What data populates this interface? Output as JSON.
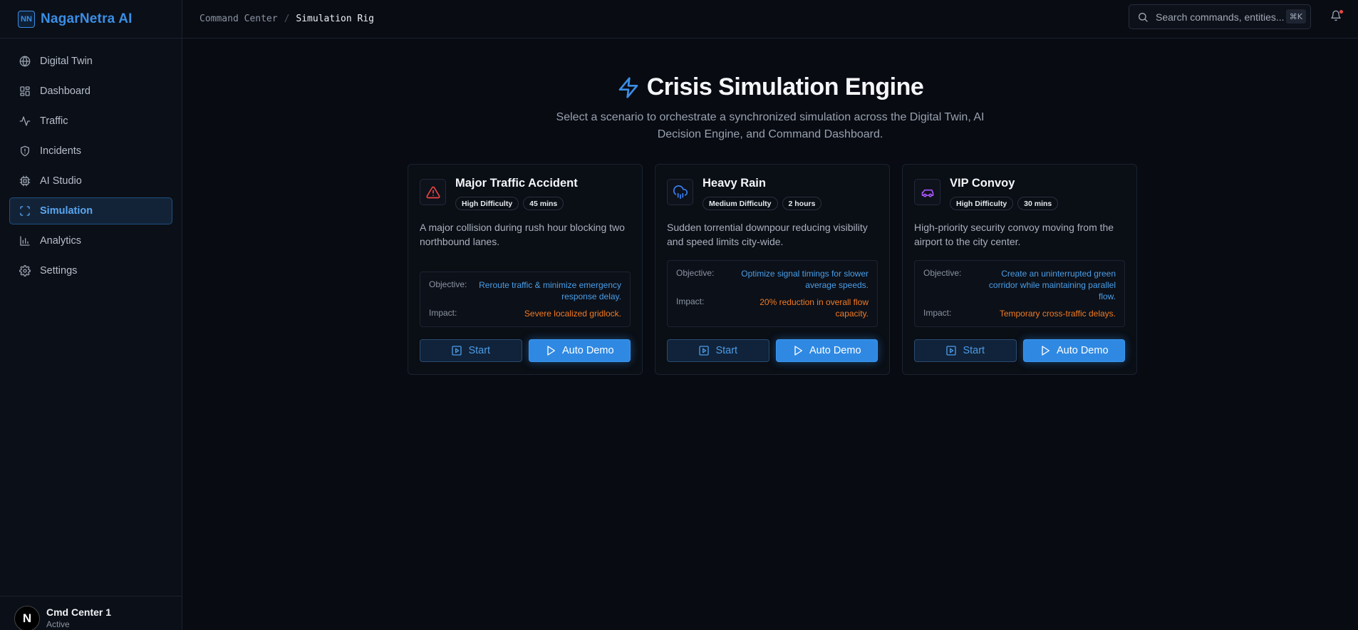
{
  "app": {
    "logo_mark": "NN",
    "name": "NagarNetra AI"
  },
  "sidebar": {
    "items": [
      {
        "label": "Digital Twin",
        "icon": "globe-icon",
        "active": false
      },
      {
        "label": "Dashboard",
        "icon": "grid-icon",
        "active": false
      },
      {
        "label": "Traffic",
        "icon": "activity-icon",
        "active": false
      },
      {
        "label": "Incidents",
        "icon": "shield-icon",
        "active": false
      },
      {
        "label": "AI Studio",
        "icon": "cpu-icon",
        "active": false
      },
      {
        "label": "Simulation",
        "icon": "scan-icon",
        "active": true
      },
      {
        "label": "Analytics",
        "icon": "bar-chart-icon",
        "active": false
      },
      {
        "label": "Settings",
        "icon": "gear-icon",
        "active": false
      }
    ],
    "user": {
      "initial": "N",
      "name": "Cmd Center 1",
      "status": "Active"
    }
  },
  "topbar": {
    "breadcrumb": [
      "Command Center",
      "Simulation Rig"
    ],
    "separator": "/",
    "search_placeholder": "Search commands, entities...",
    "shortcut": "⌘K"
  },
  "hero": {
    "title": "Crisis Simulation Engine",
    "subtitle": "Select a scenario to orchestrate a synchronized simulation across the Digital Twin, AI Decision Engine, and Command Dashboard."
  },
  "labels": {
    "objective": "Objective:",
    "impact": "Impact:",
    "start": "Start",
    "auto_demo": "Auto Demo"
  },
  "scenarios": [
    {
      "title": "Major Traffic Accident",
      "icon": "alert-triangle-icon",
      "icon_color": "#ef4444",
      "difficulty": "High Difficulty",
      "duration": "45 mins",
      "description": "A major collision during rush hour blocking two northbound lanes.",
      "objective": "Reroute traffic & minimize emergency response delay.",
      "impact": "Severe localized gridlock."
    },
    {
      "title": "Heavy Rain",
      "icon": "cloud-rain-icon",
      "icon_color": "#3b82f6",
      "difficulty": "Medium Difficulty",
      "duration": "2 hours",
      "description": "Sudden torrential downpour reducing visibility and speed limits city-wide.",
      "objective": "Optimize signal timings for slower average speeds.",
      "impact": "20% reduction in overall flow capacity."
    },
    {
      "title": "VIP Convoy",
      "icon": "car-icon",
      "icon_color": "#a855f7",
      "difficulty": "High Difficulty",
      "duration": "30 mins",
      "description": "High-priority security convoy moving from the airport to the city center.",
      "objective": "Create an uninterrupted green corridor while maintaining parallel flow.",
      "impact": "Temporary cross-traffic delays."
    }
  ],
  "colors": {
    "accent": "#2f89e3",
    "objective": "#4a9ee8",
    "impact": "#f27a22",
    "background": "#080b12"
  }
}
